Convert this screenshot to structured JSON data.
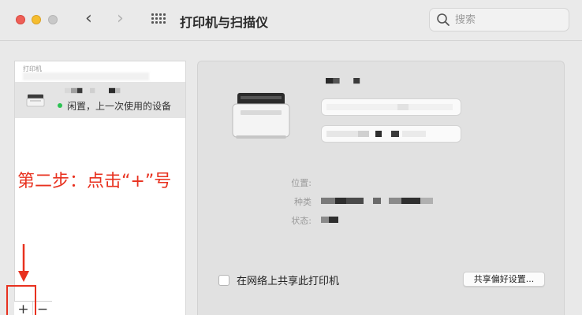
{
  "window": {
    "title": "打印机与扫描仪",
    "nav_back_icon": "‹",
    "nav_forward_icon": "›"
  },
  "search": {
    "placeholder": "搜索"
  },
  "printer_list": {
    "header": "打印机",
    "items": [
      {
        "status": "闲置，上一次使用的设备"
      }
    ],
    "add_button": "+",
    "remove_button": "−"
  },
  "annotation": {
    "text": "第二步：点击“+”号",
    "color": "#e8311f"
  },
  "details": {
    "labels": {
      "location": "位置:",
      "kind": "种类",
      "status": "状态:"
    },
    "share_label": "在网络上共享此打印机",
    "share_checked": false,
    "share_prefs_button": "共享偏好设置..."
  },
  "colors": {
    "status_dot": "#2cc253",
    "close": "#ee5f57",
    "minimize": "#f5bd2f",
    "maximize": "#c8c8c8"
  }
}
